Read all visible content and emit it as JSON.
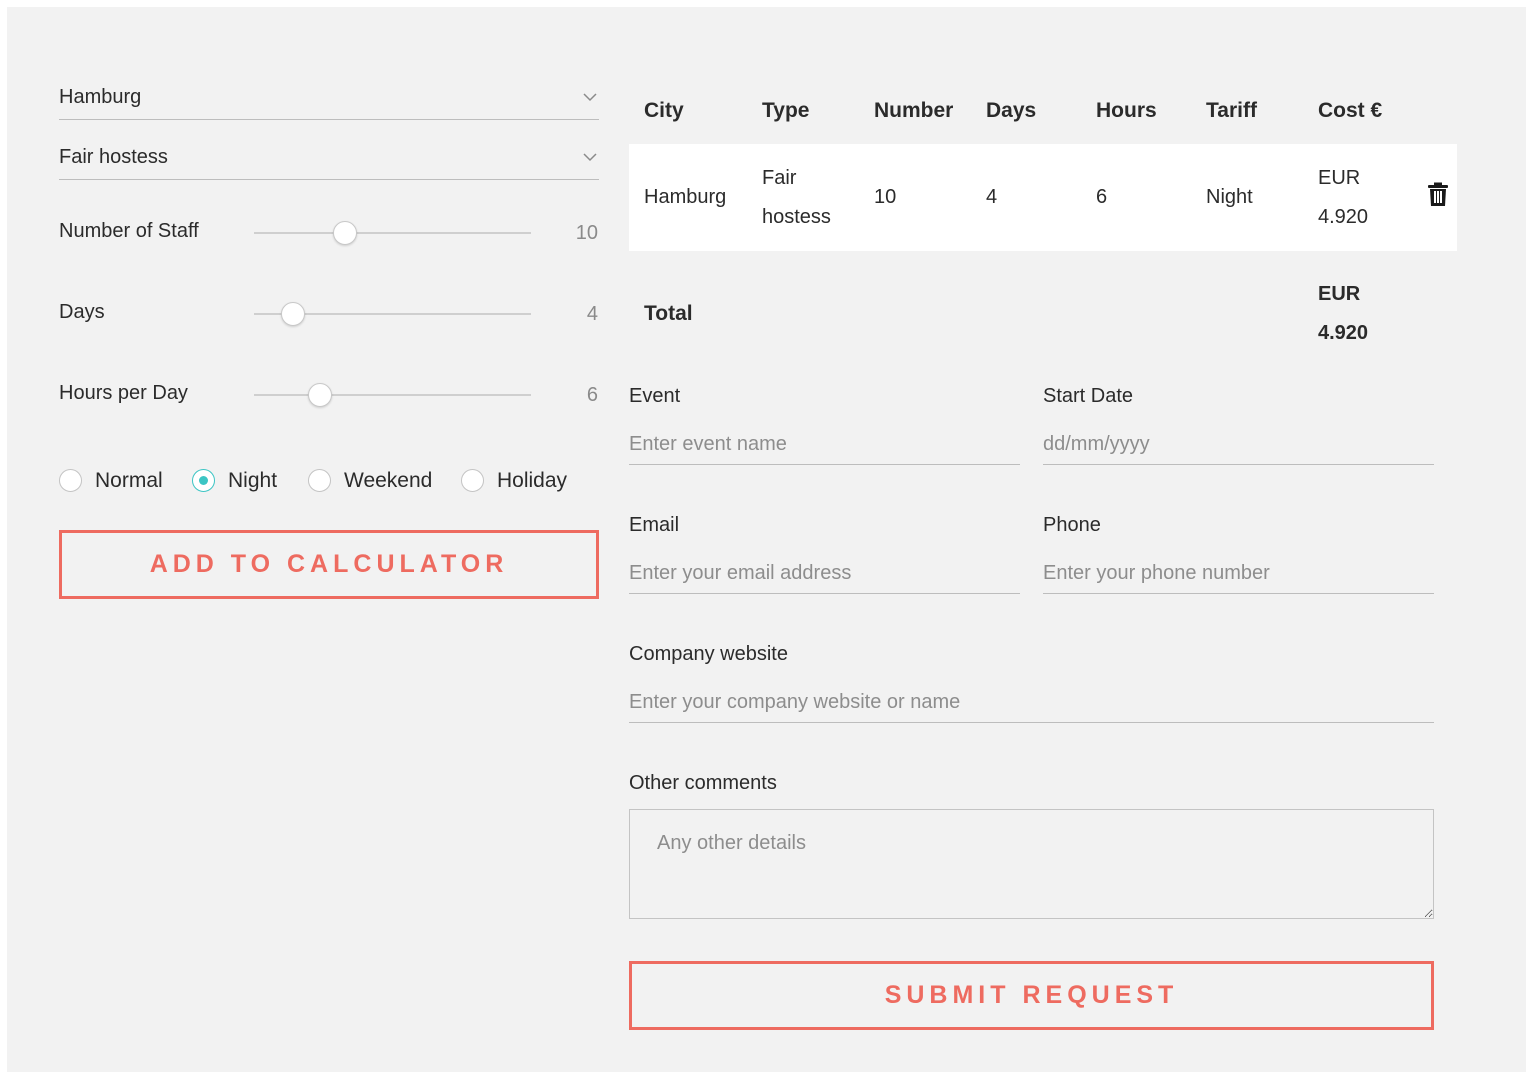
{
  "left": {
    "city_select": {
      "value": "Hamburg"
    },
    "type_select": {
      "value": "Fair hostess"
    },
    "sliders": [
      {
        "label": "Number of Staff",
        "value": "10",
        "level": 0.33
      },
      {
        "label": "Days",
        "value": "4",
        "level": 0.14
      },
      {
        "label": "Hours per Day",
        "value": "6",
        "level": 0.24
      }
    ],
    "tariffs": [
      {
        "label": "Normal",
        "checked": false
      },
      {
        "label": "Night",
        "checked": true
      },
      {
        "label": "Weekend",
        "checked": false
      },
      {
        "label": "Holiday",
        "checked": false
      }
    ],
    "add_button": "ADD TO CALCULATOR"
  },
  "table": {
    "headers": [
      "City",
      "Type",
      "Number",
      "Days",
      "Hours",
      "Tariff",
      "Cost €"
    ],
    "row": {
      "city": "Hamburg",
      "type_line1": "Fair",
      "type_line2": "hostess",
      "number": "10",
      "days": "4",
      "hours": "6",
      "tariff": "Night",
      "cost_line1": "EUR",
      "cost_line2": "4.920",
      "delete_icon": "trash-icon"
    },
    "total": {
      "label": "Total",
      "currency": "EUR",
      "amount": "4.920"
    }
  },
  "form": {
    "event": {
      "label": "Event",
      "placeholder": "Enter event name"
    },
    "start_date": {
      "label": "Start Date",
      "placeholder": "dd/mm/yyyy"
    },
    "email": {
      "label": "Email",
      "placeholder": "Enter your email address"
    },
    "phone": {
      "label": "Phone",
      "placeholder": "Enter your phone number"
    },
    "website": {
      "label": "Company website",
      "placeholder": "Enter your company website or name"
    },
    "comments": {
      "label": "Other comments",
      "placeholder": "Any other details"
    },
    "submit": "SUBMIT REQUEST"
  },
  "colors": {
    "accent": "#ee6b60",
    "radio_on": "#3cc5c4",
    "background": "#f2f2f2"
  }
}
